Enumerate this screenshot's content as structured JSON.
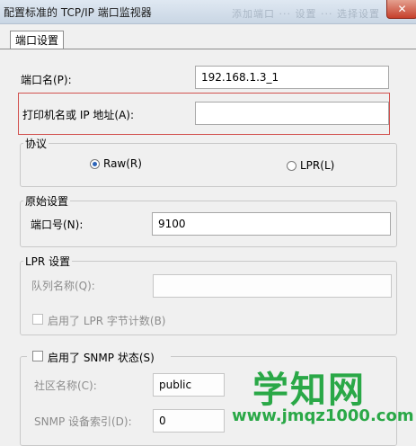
{
  "window": {
    "title": "配置标准的 TCP/IP 端口监视器",
    "title_ghost": "添加端口 ··· 设置 ··· 选择设置",
    "close_glyph": "✕"
  },
  "tabs": [
    {
      "label": "端口设置"
    }
  ],
  "port": {
    "name_label": "端口名(P):",
    "name_value": "192.168.1.3_1",
    "printer_label": "打印机名或 IP 地址(A):",
    "printer_value": ""
  },
  "protocol": {
    "title": "协议",
    "raw_label": "Raw(R)",
    "lpr_label": "LPR(L)",
    "selected": "Raw"
  },
  "raw_settings": {
    "title": "原始设置",
    "port_label": "端口号(N):",
    "port_value": "9100"
  },
  "lpr_settings": {
    "title": "LPR 设置",
    "queue_label": "队列名称(Q):",
    "queue_value": "",
    "byte_count_label": "启用了 LPR 字节计数(B)"
  },
  "snmp": {
    "enable_label": "启用了 SNMP 状态(S)",
    "community_label": "社区名称(C):",
    "community_value": "public",
    "index_label": "SNMP 设备索引(D):",
    "index_value": "0"
  },
  "watermark": {
    "brand": "学知网",
    "url": "www.jmqz1000.com"
  },
  "colors": {
    "highlight_box": "#d2524f",
    "watermark": "#2aa847",
    "radio_selected": "#2d64b8"
  }
}
